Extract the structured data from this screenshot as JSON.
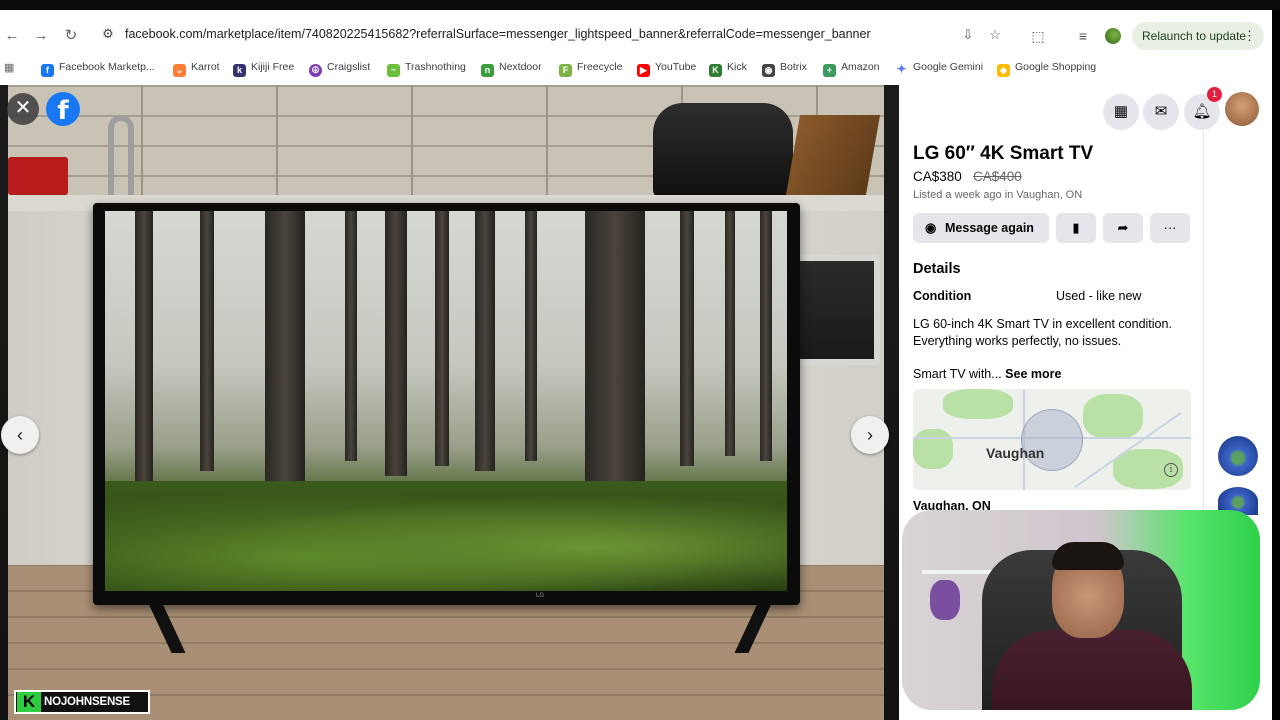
{
  "browser": {
    "url": "facebook.com/marketplace/item/740820225415682?referralSurface=messenger_lightspeed_banner&referralCode=messenger_banner",
    "relaunch_label": "Relaunch to update",
    "bookmarks": [
      {
        "label": "Facebook Marketp...",
        "icon": "facebook-icon",
        "color": "#1877f2"
      },
      {
        "label": "Karrot",
        "icon": "carrot-icon",
        "color": "#ff7e36"
      },
      {
        "label": "Kijiji Free",
        "icon": "kijiji-icon",
        "color": "#373373"
      },
      {
        "label": "Craigslist",
        "icon": "peace-icon",
        "color": "#7d3cb5"
      },
      {
        "label": "Trashnothing",
        "icon": "leaf-icon",
        "color": "#6cbf3c"
      },
      {
        "label": "Nextdoor",
        "icon": "nextdoor-icon",
        "color": "#3c9d40"
      },
      {
        "label": "Freecycle",
        "icon": "freecycle-icon",
        "color": "#7cb342"
      },
      {
        "label": "YouTube",
        "icon": "youtube-icon",
        "color": "#ff0000"
      },
      {
        "label": "Kick",
        "icon": "kick-icon",
        "color": "#2e7d32"
      },
      {
        "label": "Botrix",
        "icon": "botrix-icon",
        "color": "#444444"
      },
      {
        "label": "Amazon",
        "icon": "amazon-icon",
        "color": "#3a9b5c"
      },
      {
        "label": "Google Gemini",
        "icon": "gemini-icon",
        "color": "#5b7cfa"
      },
      {
        "label": "Google Shopping",
        "icon": "shopping-icon",
        "color": "#fbbc04"
      }
    ]
  },
  "viewer": {
    "watermark": "NOJOHNSENSE",
    "watermark_k": "K",
    "tv_brand": "LG"
  },
  "listing": {
    "title": "LG 60″ 4K Smart TV",
    "price": "CA$380",
    "original_price": "CA$400",
    "listed": "Listed a week ago in Vaughan, ON",
    "message_label": "Message again",
    "details_heading": "Details",
    "condition_label": "Condition",
    "condition_value": "Used - like new",
    "description": "LG 60-inch 4K Smart TV in excellent condition. Everything works perfectly, no issues.",
    "description_more": "Smart TV with...",
    "see_more": "See more",
    "map_label": "Vaughan",
    "location": "Vaughan, ON"
  },
  "header": {
    "notification_count": "1"
  },
  "colors": {
    "facebook_blue": "#1877f2",
    "button_gray": "#e4e6eb",
    "badge_red": "#e41e3f"
  }
}
